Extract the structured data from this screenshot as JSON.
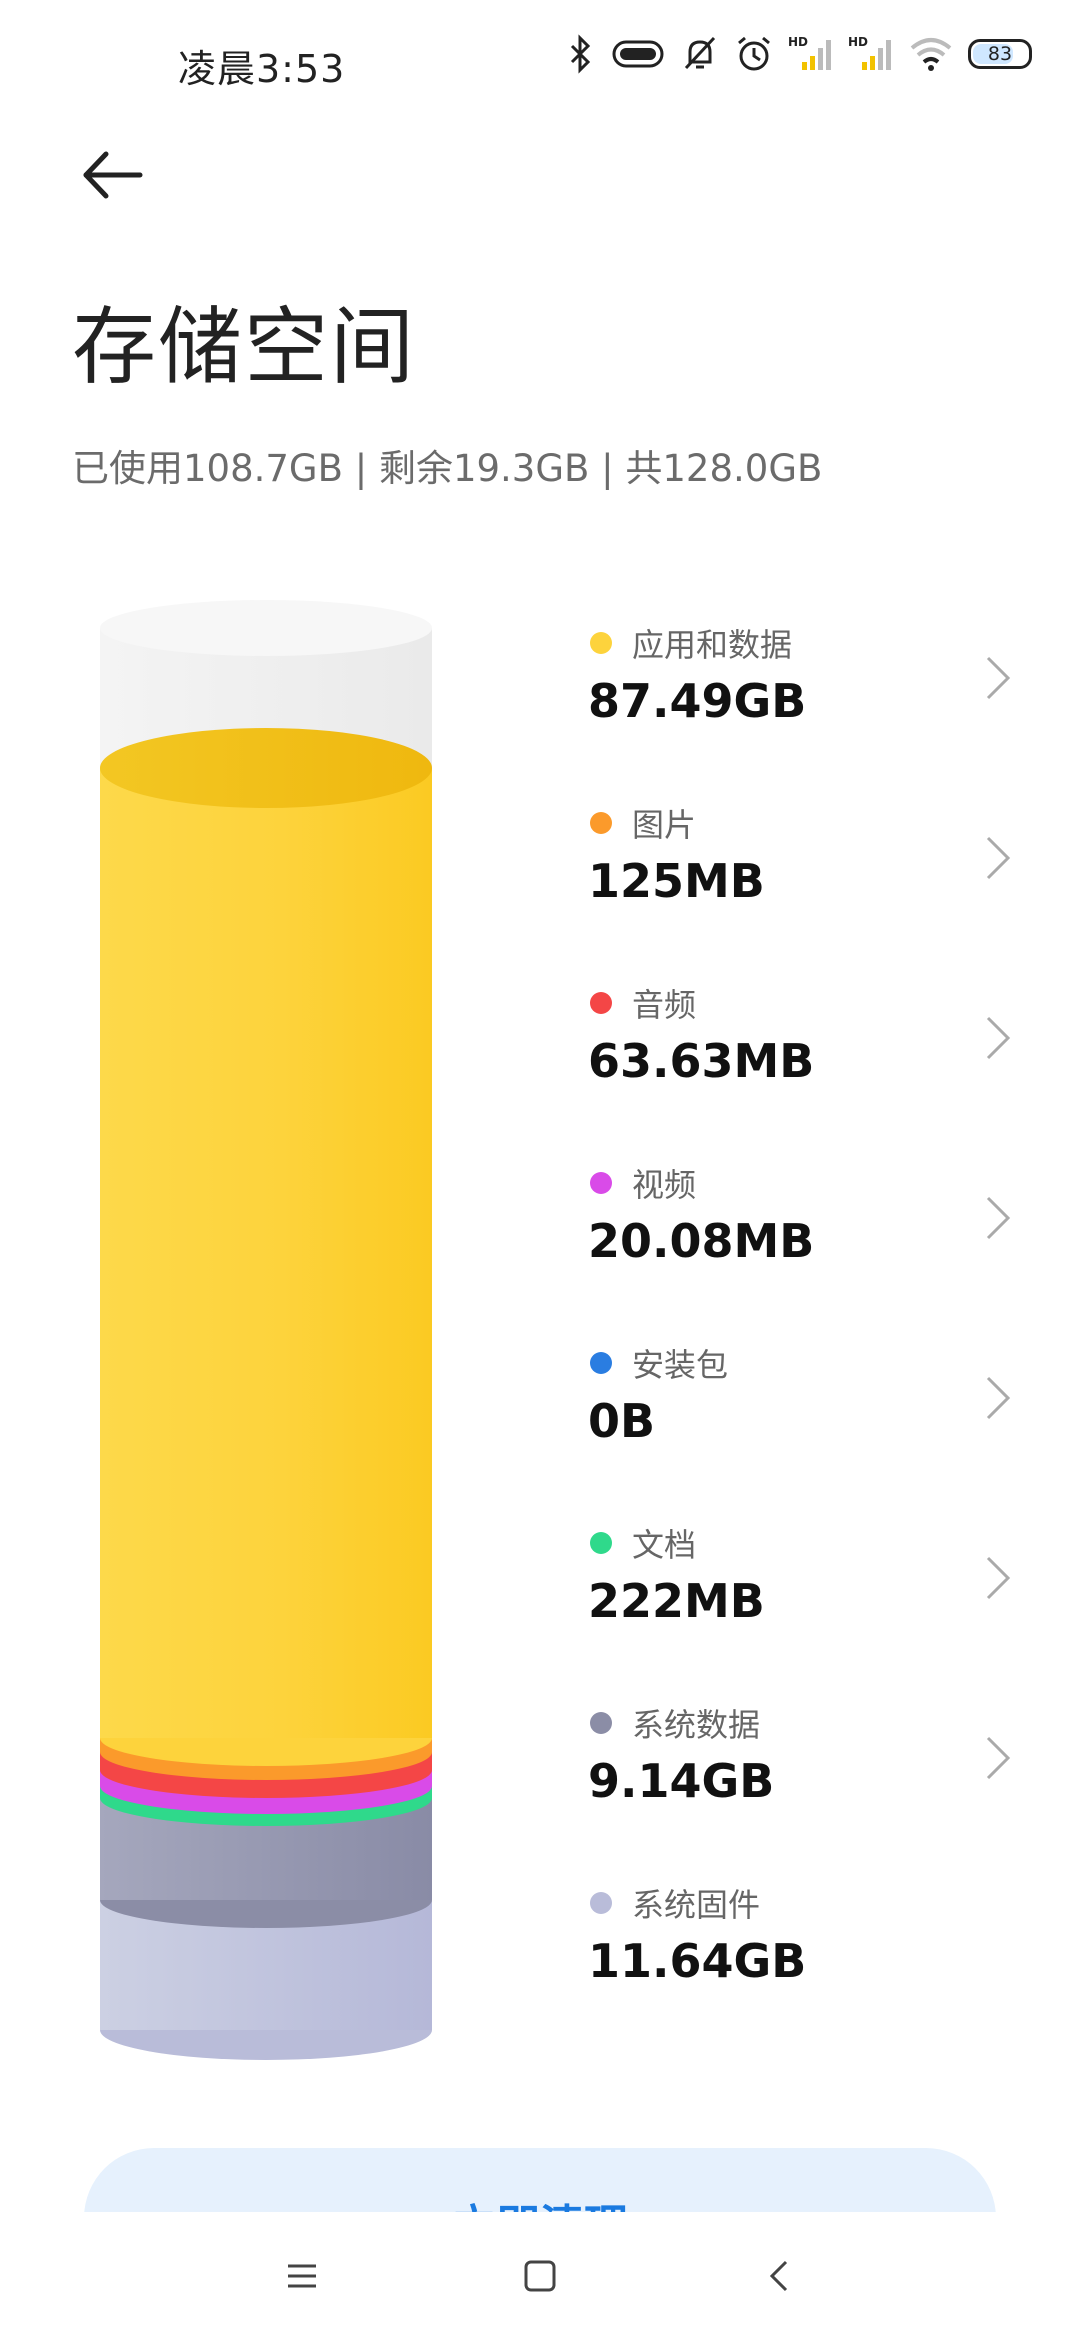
{
  "status_bar": {
    "time": "凌晨3:53",
    "battery": "83",
    "icons": [
      "bluetooth-icon",
      "vibrate-icon",
      "mute-icon",
      "alarm-icon",
      "signal-hd-icon",
      "signal-hd-icon",
      "wifi-icon",
      "battery-icon"
    ]
  },
  "header": {
    "title": "存储空间",
    "summary": "已使用108.7GB | 剩余19.3GB | 共128.0GB"
  },
  "storage_items": [
    {
      "label": "应用和数据",
      "value": "87.49GB",
      "color": "#fdd33c",
      "chevron": true
    },
    {
      "label": "图片",
      "value": "125MB",
      "color": "#fb9a2b",
      "chevron": true
    },
    {
      "label": "音频",
      "value": "63.63MB",
      "color": "#f44646",
      "chevron": true
    },
    {
      "label": "视频",
      "value": "20.08MB",
      "color": "#d94be8",
      "chevron": true
    },
    {
      "label": "安装包",
      "value": "0B",
      "color": "#2a7de1",
      "chevron": true
    },
    {
      "label": "文档",
      "value": "222MB",
      "color": "#2fd98b",
      "chevron": true
    },
    {
      "label": "系统数据",
      "value": "9.14GB",
      "color": "#8b8da6",
      "chevron": true
    },
    {
      "label": "系统固件",
      "value": "11.64GB",
      "color": "#b9bcd9",
      "chevron": false
    }
  ],
  "cleanup_button": {
    "label": "立即清理"
  },
  "nav_bar": {
    "icons": [
      "menu-icon",
      "home-icon",
      "back-icon"
    ]
  }
}
